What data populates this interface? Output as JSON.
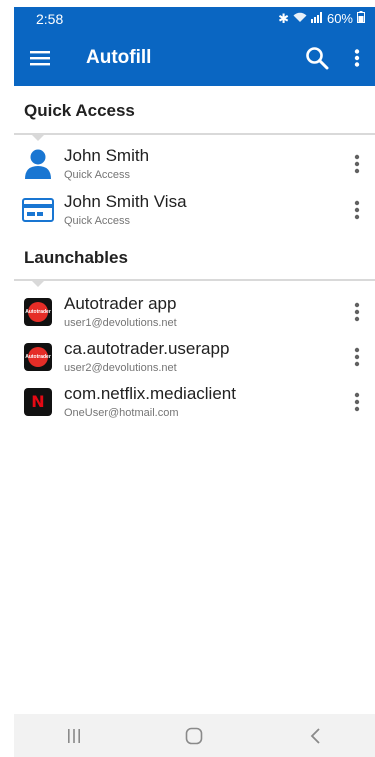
{
  "status_bar": {
    "time": "2:58",
    "battery": "60%"
  },
  "app_bar": {
    "title": "Autofill"
  },
  "sections": {
    "quick_access": {
      "title": "Quick Access",
      "items": [
        {
          "name": "John Smith",
          "sub": "Quick Access",
          "icon": "user-icon"
        },
        {
          "name": "John Smith Visa",
          "sub": "Quick Access",
          "icon": "credit-card-icon"
        }
      ]
    },
    "launchables": {
      "title": "Launchables",
      "items": [
        {
          "name": "Autotrader app",
          "sub": "user1@devolutions.net",
          "icon": "autotrader-icon"
        },
        {
          "name": "ca.autotrader.userapp",
          "sub": "user2@devolutions.net",
          "icon": "autotrader-icon"
        },
        {
          "name": "com.netflix.mediaclient",
          "sub": "OneUser@hotmail.com",
          "icon": "netflix-icon"
        }
      ]
    }
  },
  "colors": {
    "primary": "#0a66c2",
    "icon_blue": "#1976d2",
    "nav_bar": "#f2f2f2"
  }
}
